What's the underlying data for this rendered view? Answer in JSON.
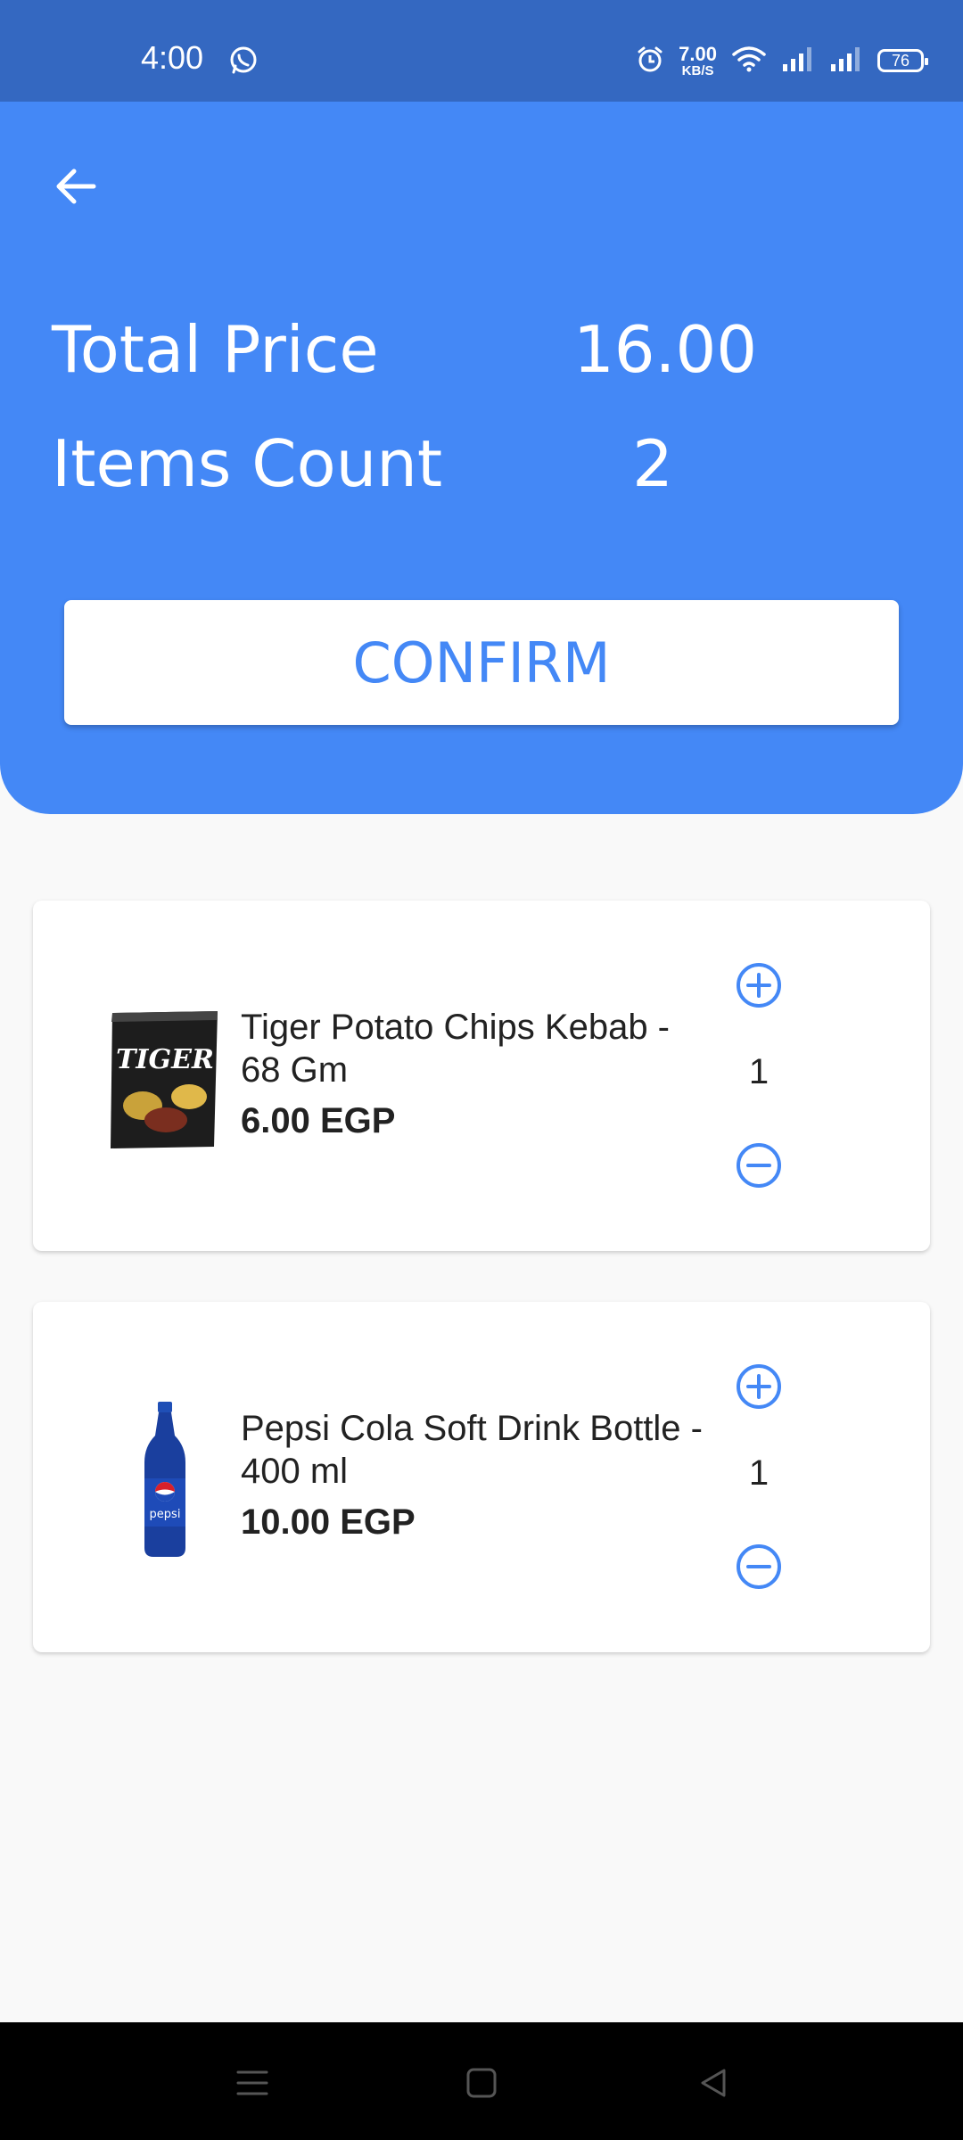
{
  "status_bar": {
    "time": "4:00",
    "net_speed_value": "7.00",
    "net_speed_unit": "KB/S",
    "battery": "76",
    "icons": [
      "whatsapp-icon",
      "alarm-icon",
      "wifi-icon",
      "signal-icon",
      "signal-icon",
      "battery-icon"
    ]
  },
  "header": {
    "back_icon": "arrow-left-icon",
    "total_price_label": "Total Price",
    "total_price_value": "16.00",
    "items_count_label": "Items Count",
    "items_count_value": "2",
    "confirm_label": "CONFIRM"
  },
  "cart": {
    "items": [
      {
        "name": "Tiger Potato Chips Kebab - 68 Gm",
        "price": "6.00 EGP",
        "quantity": "1",
        "image_brand": "TIGER",
        "image_alt": "Tiger chips bag"
      },
      {
        "name": "Pepsi Cola Soft Drink Bottle - 400 ml",
        "price": "10.00 EGP",
        "quantity": "1",
        "image_brand": "pepsi",
        "image_alt": "Pepsi bottle"
      }
    ]
  },
  "nav_bar": {
    "icons": [
      "menu-icon",
      "home-square-icon",
      "back-triangle-icon"
    ]
  },
  "colors": {
    "primary": "#4488f6",
    "status_bar": "#3468c1",
    "background": "#f9f9f9",
    "text": "#222222"
  }
}
